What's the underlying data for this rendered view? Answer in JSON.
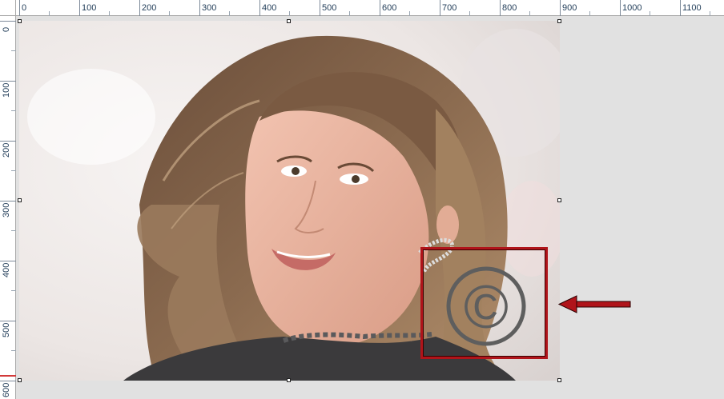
{
  "ruler": {
    "top_labels": [
      "0",
      "100",
      "200",
      "300",
      "400",
      "500",
      "600",
      "700",
      "800",
      "900",
      "1000",
      "1100"
    ],
    "left_labels": [
      "0",
      "100",
      "200",
      "300",
      "400",
      "500",
      "600"
    ]
  },
  "image": {
    "subject": "portrait of a smiling woman with long wavy brown hair wearing a dark ruffled top and a sparkly ear cuff",
    "background_color": "#f1eeee",
    "watermark_symbol": "©"
  },
  "annotation": {
    "box_color": "#b0141a",
    "arrow_color": "#b0141a"
  },
  "icons": {
    "copyright": "copyright-icon",
    "arrow": "left-arrow-icon"
  }
}
